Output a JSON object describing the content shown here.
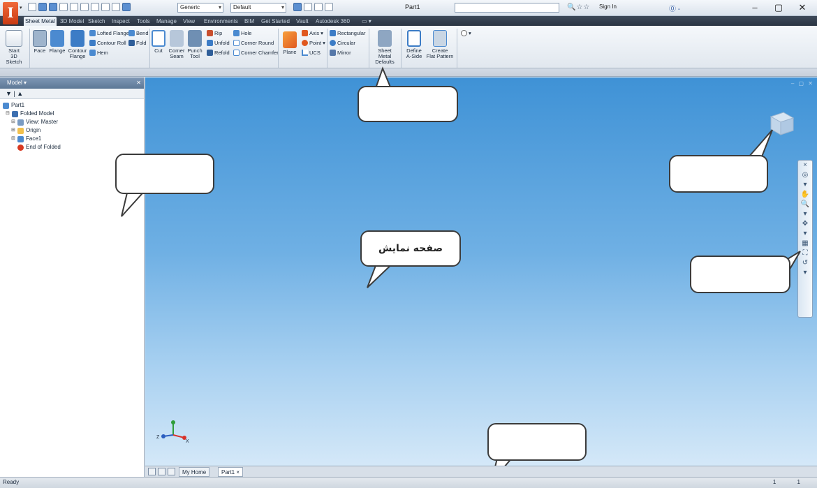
{
  "app": {
    "logo_letter": "I"
  },
  "titlebar": {
    "material_value": "Generic",
    "appearance_value": "Default",
    "document_title": "Part1",
    "signin_label": "Sign In",
    "help_label": "⓪ -",
    "minimize_label": "–",
    "maximize_label": "▢",
    "close_label": "✕"
  },
  "tabs": [
    "Sheet Metal",
    "3D Model",
    "Sketch",
    "Inspect",
    "Tools",
    "Manage",
    "View",
    "Environments",
    "BIM",
    "Get Started",
    "Vault",
    "Autodesk 360"
  ],
  "ribbon": {
    "start_sketch": [
      "Start",
      "3D Sketch"
    ],
    "face": "Face",
    "flange": "Flange",
    "contour_flange": [
      "Contour",
      "Flange"
    ],
    "lofted_flange": "Lofted Flange",
    "contour_roll": "Contour Roll",
    "hem": "Hem",
    "bend": "Bend",
    "fold": "Fold",
    "cut": "Cut",
    "corner_seam": [
      "Corner",
      "Seam"
    ],
    "punch_tool": [
      "Punch",
      "Tool"
    ],
    "rip": "Rip",
    "unfold": "Unfold",
    "refold": "Refold",
    "hole": "Hole",
    "corner_round": "Corner Round",
    "corner_chamfer": "Corner Chamfer",
    "plane": "Plane",
    "axis": "Axis",
    "point": "Point",
    "ucs": "UCS",
    "rectangular": "Rectangular",
    "circular": "Circular",
    "mirror": "Mirror",
    "sheet_metal_defaults": [
      "Sheet Metal",
      "Defaults"
    ],
    "define_a_side": [
      "Define",
      "A-Side"
    ],
    "create_flat_pattern": [
      "Create",
      "Flat Pattern"
    ]
  },
  "browser": {
    "title": "Model ▾",
    "tools_label": "▼ | ▲",
    "close_label": "✕",
    "tree": [
      {
        "label": "Part1",
        "level": 0,
        "expander": ""
      },
      {
        "label": "Folded Model",
        "level": 1,
        "expander": "⊟"
      },
      {
        "label": "View: Master",
        "level": 2,
        "expander": "⊞"
      },
      {
        "label": "Origin",
        "level": 2,
        "expander": "⊞"
      },
      {
        "label": "Face1",
        "level": 2,
        "expander": "⊞"
      },
      {
        "label": "End of Folded",
        "level": 2,
        "expander": ""
      }
    ]
  },
  "viewport": {
    "graphics_callout": "صفحه نمایش",
    "triad_labels": {
      "x": "X",
      "y": "Y",
      "z": "Z"
    }
  },
  "doc_tabs": {
    "my_home": "My Home",
    "part1": "Part1"
  },
  "status": {
    "text": "Ready",
    "right": "1 1"
  },
  "colors": {
    "viewport_top": "#3f92d6",
    "viewport_bottom": "#d4e8f8",
    "tab_bar": "#2a3442",
    "accent_orange": "#e0581f"
  }
}
